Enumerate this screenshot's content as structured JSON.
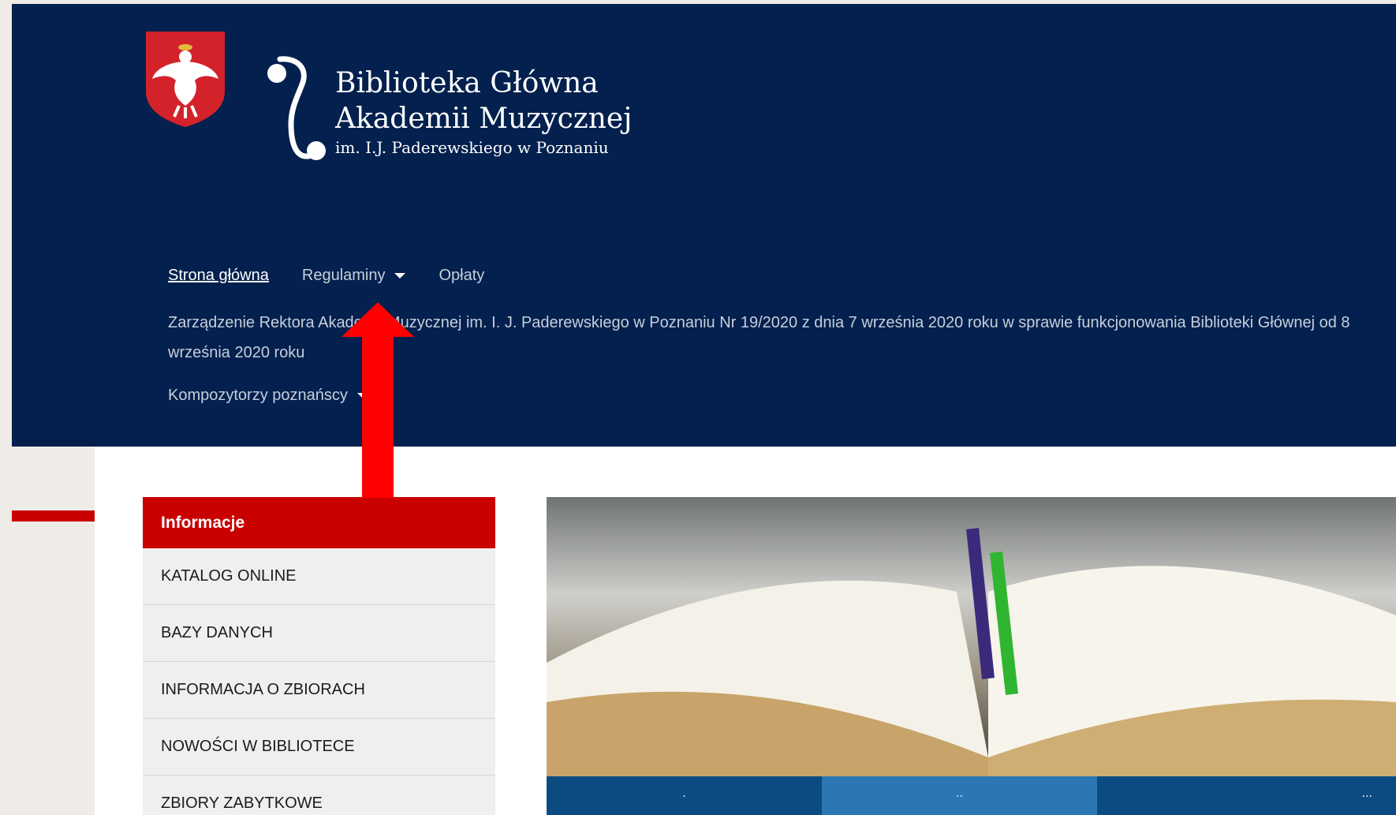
{
  "header": {
    "logo_line1": "Biblioteka Główna",
    "logo_line2": "Akademii Muzycznej",
    "logo_line3": "im. I.J. Paderewskiego w Poznaniu",
    "background_color": "#03204e"
  },
  "nav": {
    "home": "Strona główna",
    "regulations": "Regulaminy",
    "fees": "Opłaty",
    "ordinance": "Zarządzenie Rektora Akademii Muzycznej im. I. J. Paderewskiego w Poznaniu Nr 19/2020 z dnia 7 września 2020 roku w sprawie funkcjonowania Biblioteki Głównej od 8 września 2020 roku",
    "composers": "Kompozytorzy poznańscy"
  },
  "sidebar": {
    "heading": "Informacje",
    "heading_color": "#c90000",
    "items": [
      {
        "label": "KATALOG ONLINE"
      },
      {
        "label": "BAZY DANYCH"
      },
      {
        "label": "INFORMACJA O ZBIORACH"
      },
      {
        "label": "NOWOŚCI W BIBLIOTECE"
      },
      {
        "label": "ZBIORY ZABYTKOWE"
      }
    ]
  },
  "slider": {
    "dots": [
      ".",
      "..",
      "..."
    ]
  },
  "annotation": {
    "arrow_color": "#ff0000"
  }
}
